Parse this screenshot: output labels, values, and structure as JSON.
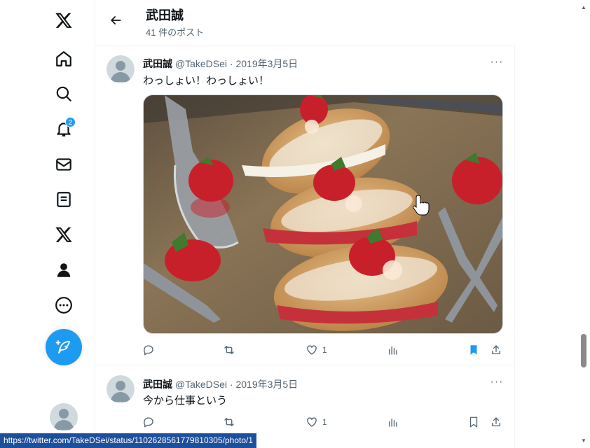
{
  "nav": {
    "notifications_badge": "2",
    "items": [
      "home-icon",
      "search-icon",
      "bell-icon",
      "mail-icon",
      "lists-icon",
      "x-premium-icon",
      "profile-icon",
      "more-icon"
    ]
  },
  "header": {
    "name": "武田誠",
    "post_count": "41 件のポスト"
  },
  "tweets": [
    {
      "name": "武田誠",
      "handle": "@TakeDSei · 2019年3月5日",
      "text": "わっしょい！わっしょい！",
      "likes": "1",
      "bookmarked": true
    },
    {
      "name": "武田誠",
      "handle": "@TakeDSei · 2019年3月5日",
      "text": "今から仕事という",
      "likes": "1",
      "bookmarked": false
    }
  ],
  "colors": {
    "accent": "#1d9bf0",
    "text_secondary": "#536471"
  },
  "status_url": "https://twitter.com/TakeDSei/status/1102628561779810305/photo/1"
}
